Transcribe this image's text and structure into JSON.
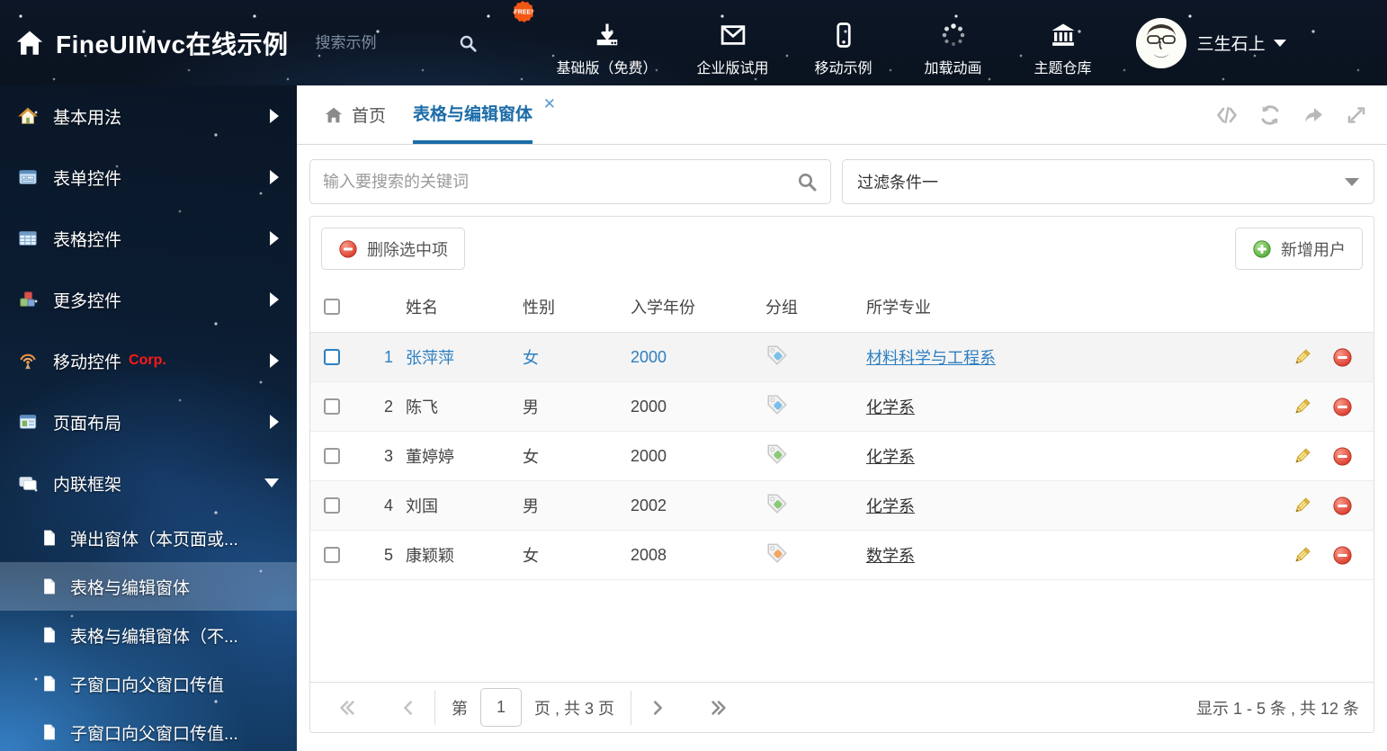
{
  "header": {
    "title": "FineUIMvc在线示例",
    "search_placeholder": "搜索示例",
    "free_badge": "FREE!",
    "nav": [
      {
        "label": "基础版（免费）",
        "icon": "download-icon"
      },
      {
        "label": "企业版试用",
        "icon": "envelope-icon"
      },
      {
        "label": "移动示例",
        "icon": "mobile-icon"
      },
      {
        "label": "加载动画",
        "icon": "spinner-icon"
      },
      {
        "label": "主题仓库",
        "icon": "bank-icon"
      }
    ],
    "user": {
      "name": "三生石上"
    }
  },
  "sidebar": {
    "items": [
      {
        "label": "基本用法"
      },
      {
        "label": "表单控件"
      },
      {
        "label": "表格控件"
      },
      {
        "label": "更多控件"
      },
      {
        "label": "移动控件",
        "badge": "Corp."
      },
      {
        "label": "页面布局"
      },
      {
        "label": "内联框架"
      }
    ],
    "subitems": [
      {
        "label": "弹出窗体（本页面或..."
      },
      {
        "label": "表格与编辑窗体"
      },
      {
        "label": "表格与编辑窗体（不..."
      },
      {
        "label": "子窗口向父窗口传值"
      },
      {
        "label": "子窗口向父窗口传值..."
      }
    ]
  },
  "main": {
    "tabs": [
      {
        "label": "首页"
      },
      {
        "label": "表格与编辑窗体",
        "active": true,
        "close_glyph": "✕"
      }
    ],
    "search_placeholder": "输入要搜索的关键词",
    "filter_value": "过滤条件一",
    "toolbar": {
      "delete_label": "删除选中项",
      "add_label": "新增用户"
    },
    "table": {
      "columns": [
        "姓名",
        "性别",
        "入学年份",
        "分组",
        "所学专业"
      ],
      "rows": [
        {
          "num": "1",
          "name": "张萍萍",
          "gender": "女",
          "year": "2000",
          "tag": "blue",
          "major": "材料科学与工程系"
        },
        {
          "num": "2",
          "name": "陈飞",
          "gender": "男",
          "year": "2000",
          "tag": "blue",
          "major": "化学系"
        },
        {
          "num": "3",
          "name": "董婷婷",
          "gender": "女",
          "year": "2000",
          "tag": "green",
          "major": "化学系"
        },
        {
          "num": "4",
          "name": "刘国",
          "gender": "男",
          "year": "2002",
          "tag": "green",
          "major": "化学系"
        },
        {
          "num": "5",
          "name": "康颖颖",
          "gender": "女",
          "year": "2008",
          "tag": "orange",
          "major": "数学系"
        }
      ]
    },
    "pagination": {
      "prefix": "第",
      "page_value": "1",
      "suffix": "页 , 共 3 页",
      "summary": "显示 1 - 5 条 , 共 12 条"
    }
  },
  "colors": {
    "accent_blue": "#1b6ca8",
    "selected_row_blue": "#2e7fc1",
    "tag_blue": "#7cc0ea",
    "tag_green": "#8cc87a",
    "tag_orange": "#f0a868",
    "delete_red": "#d93a2b",
    "add_green": "#56ab3c",
    "free_badge_orange": "#f04a10",
    "header_bg": "#0b1422"
  }
}
